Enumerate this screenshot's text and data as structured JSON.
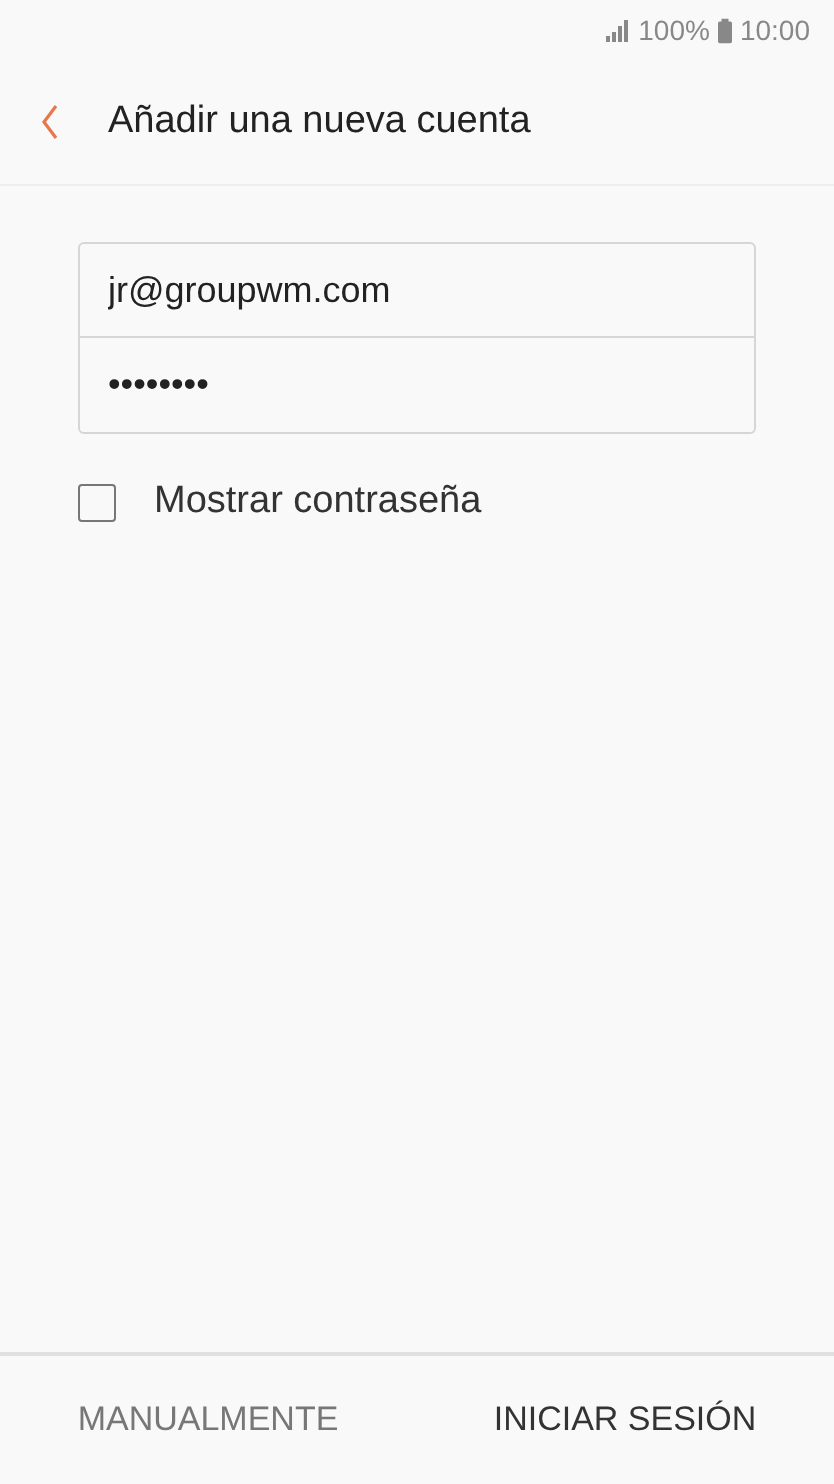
{
  "status_bar": {
    "battery": "100%",
    "time": "10:00"
  },
  "header": {
    "title": "Añadir una nueva cuenta"
  },
  "fields": [
    {
      "value": "jr@groupwm.com"
    },
    {
      "value": "••••••••"
    }
  ],
  "show_password": {
    "label": "Mostrar contraseña",
    "checked": false
  },
  "buttons": [
    {
      "label": "MANUALMENTE",
      "disabled": true
    },
    {
      "label": "INICIAR SESIÓN",
      "disabled": false
    }
  ]
}
